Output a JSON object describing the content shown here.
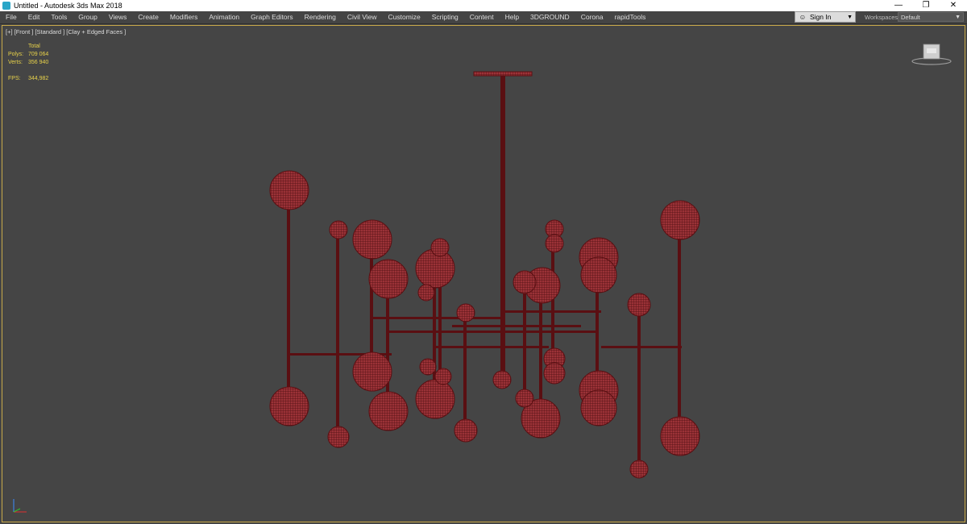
{
  "window": {
    "title": "Untitled - Autodesk 3ds Max 2018",
    "icon": "3dsmax-app-icon",
    "controls": [
      "minimize-icon",
      "restore-icon",
      "close-icon"
    ]
  },
  "menu": [
    "File",
    "Edit",
    "Tools",
    "Group",
    "Views",
    "Create",
    "Modifiers",
    "Animation",
    "Graph Editors",
    "Rendering",
    "Civil View",
    "Customize",
    "Scripting",
    "Content",
    "Help",
    "3DGROUND",
    "Corona",
    "rapidTools"
  ],
  "signin": {
    "label": "Sign In",
    "icon": "person-icon"
  },
  "workspaces": {
    "label": "Workspaces:",
    "value": "Default"
  },
  "viewport": {
    "label": "[+] [Front ] [Standard ] [Clay + Edged Faces ]",
    "stats": {
      "header": "Total",
      "polys_label": "Polys:",
      "polys": "709 064",
      "verts_label": "Verts:",
      "verts": "356 940",
      "fps_label": "FPS:",
      "fps": "344,982"
    },
    "viewcube_icon": "viewcube-icon",
    "axis_icon": "axis-tripod-icon"
  },
  "colors": {
    "wire": "#5a0f12",
    "sphere": "#9b3237",
    "viewport_border": "#c9a94a",
    "stats_text": "#e8d24a"
  }
}
